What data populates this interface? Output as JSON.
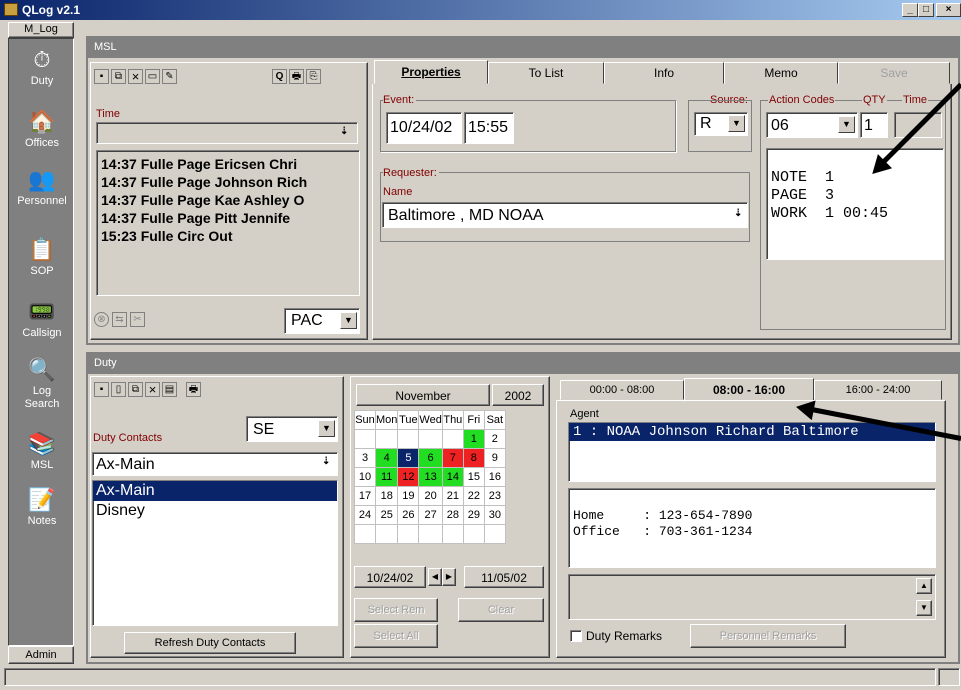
{
  "app": {
    "title": "QLog v2.1",
    "statusbar": ""
  },
  "sidebar": {
    "top_label": "M_Log",
    "bottom_label": "Admin",
    "items": [
      {
        "label": "Duty",
        "icon": "stopwatch-icon"
      },
      {
        "label": "Offices",
        "icon": "building-icon"
      },
      {
        "label": "Personnel",
        "icon": "people-icon"
      },
      {
        "label": "SOP",
        "icon": "document-icon"
      },
      {
        "label": "Callsign",
        "icon": "radio-icon"
      },
      {
        "label": "Log Search",
        "icon": "magnifier-icon"
      },
      {
        "label": "MSL",
        "icon": "book-icon"
      },
      {
        "label": "Notes",
        "icon": "notes-icon"
      }
    ]
  },
  "msl": {
    "header": "MSL",
    "time_label": "Time",
    "list": [
      "14:37 Fulle Page Ericsen Chri",
      "14:37 Fulle Page Johnson Rich",
      "14:37 Fulle Page Kae Ashley O",
      "14:37 Fulle Page Pitt Jennife",
      "15:23 Fulle Circ Out"
    ],
    "pac": "PAC"
  },
  "props": {
    "tabs": [
      "Properties",
      "To List",
      "Info",
      "Memo",
      "Save"
    ],
    "event_label": "Event:",
    "event_date": "10/24/02",
    "event_time": "15:55",
    "source_label": "Source:",
    "source_value": "R",
    "action_label": "Action Codes",
    "qty_label": "QTY",
    "time_label": "Time",
    "action_value": "06",
    "qty_value": "1",
    "codes": [
      "NOTE  1",
      "PAGE  3",
      "WORK  1 00:45"
    ],
    "requester_label": "Requester:",
    "name_label": "Name",
    "requester_value": "Baltimore , MD NOAA"
  },
  "duty": {
    "header": "Duty",
    "contacts_label": "Duty Contacts",
    "region": "SE",
    "combo": "Ax-Main",
    "list": [
      "Ax-Main",
      "Disney"
    ],
    "refresh": "Refresh Duty Contacts"
  },
  "calendar": {
    "month": "November",
    "year": "2002",
    "days": [
      "Sun",
      "Mon",
      "Tue",
      "Wed",
      "Thu",
      "Fri",
      "Sat"
    ],
    "weeks": [
      [
        "",
        "",
        "",
        "",
        "",
        "1",
        "2"
      ],
      [
        "3",
        "4",
        "5",
        "6",
        "7",
        "8",
        "9"
      ],
      [
        "10",
        "11",
        "12",
        "13",
        "14",
        "15",
        "16"
      ],
      [
        "17",
        "18",
        "19",
        "20",
        "21",
        "22",
        "23"
      ],
      [
        "24",
        "25",
        "26",
        "27",
        "28",
        "29",
        "30"
      ],
      [
        "",
        "",
        "",
        "",
        "",
        "",
        ""
      ]
    ],
    "from": "10/24/02",
    "to": "11/05/02",
    "select_rem": "Select Rem",
    "clear": "Clear",
    "select_all": "Select All"
  },
  "shifts": {
    "tabs": [
      "00:00 - 08:00",
      "08:00 - 16:00",
      "16:00 - 24:00"
    ],
    "agent_label": "Agent",
    "agent": "1 : NOAA Johnson Richard Baltimore",
    "phones": [
      "Home     : 123-654-7890",
      "Office   : 703-361-1234"
    ],
    "duty_remarks": "Duty Remarks",
    "personnel_remarks": "Personnel Remarks"
  }
}
